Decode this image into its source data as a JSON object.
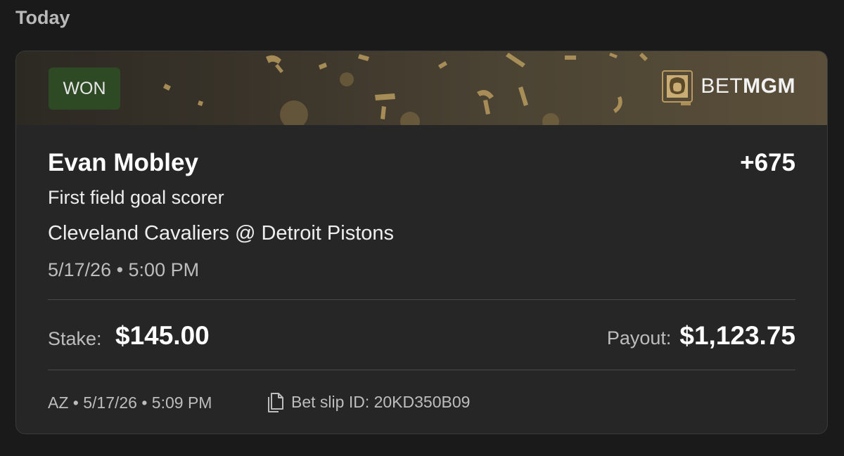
{
  "section": {
    "title": "Today"
  },
  "bet": {
    "status": "WON",
    "brand": {
      "prefix": "BET",
      "suffix": "MGM"
    },
    "player": "Evan Mobley",
    "odds": "+675",
    "market": "First field goal scorer",
    "matchup": "Cleveland Cavaliers @ Detroit Pistons",
    "event_datetime": "5/17/26 • 5:00 PM",
    "stake_label": "Stake:",
    "stake_value": "$145.00",
    "payout_label": "Payout:",
    "payout_value": "$1,123.75",
    "placed_info": "AZ • 5/17/26 • 5:09 PM",
    "slip_id": "Bet slip ID: 20KD350B09"
  },
  "colors": {
    "background": "#1a1a1a",
    "card": "#262626",
    "won_badge": "#2e4a24",
    "gold": "#b89a5e"
  },
  "icons": {
    "brand": "lion-logo-icon",
    "slip": "copy-document-icon"
  }
}
